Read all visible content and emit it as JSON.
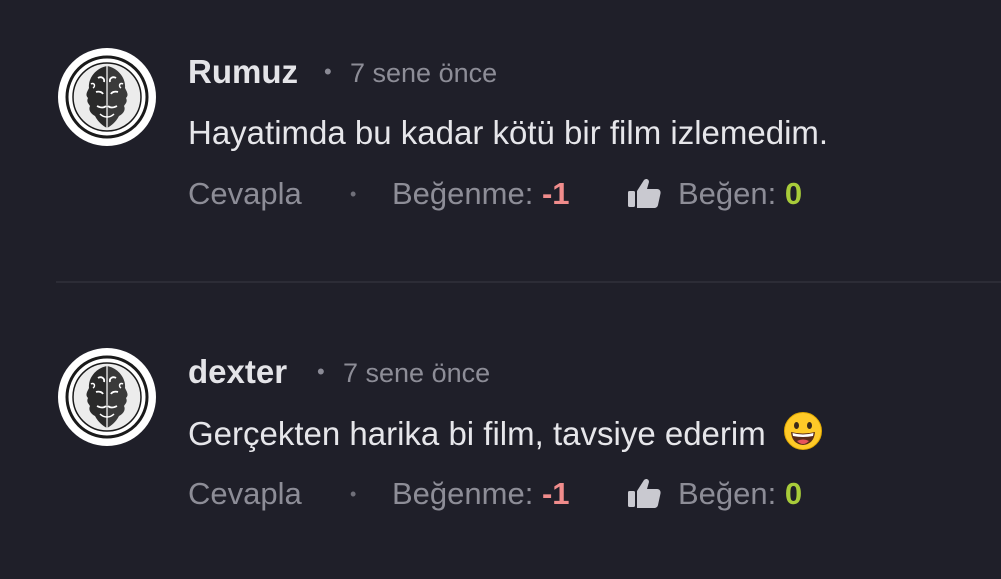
{
  "comments": [
    {
      "author": "Rumuz",
      "separator": "•",
      "time": "7 sene önce",
      "text": "Hayatimda bu kadar kötü bir film izlemedim.",
      "actions": {
        "reply": "Cevapla",
        "separator": "•",
        "dislike_label": "Beğenme:",
        "dislike_value": "-1",
        "like_label": "Beğen:",
        "like_value": "0"
      },
      "avatar_icon": "janus-coin-avatar",
      "emoji": null
    },
    {
      "author": "dexter",
      "separator": "•",
      "time": "7 sene önce",
      "text": "Gerçekten harika bi film, tavsiye ederim",
      "actions": {
        "reply": "Cevapla",
        "separator": "•",
        "dislike_label": "Beğenme:",
        "dislike_value": "-1",
        "like_label": "Beğen:",
        "like_value": "0"
      },
      "avatar_icon": "janus-coin-avatar",
      "emoji": "grinning-face-emoji"
    }
  ],
  "colors": {
    "background": "#1f1f29",
    "text": "#e6e6ea",
    "muted": "#8d8d97",
    "dislike": "#f08c8c",
    "like": "#a8cc3a",
    "divider": "#2c2c36"
  }
}
